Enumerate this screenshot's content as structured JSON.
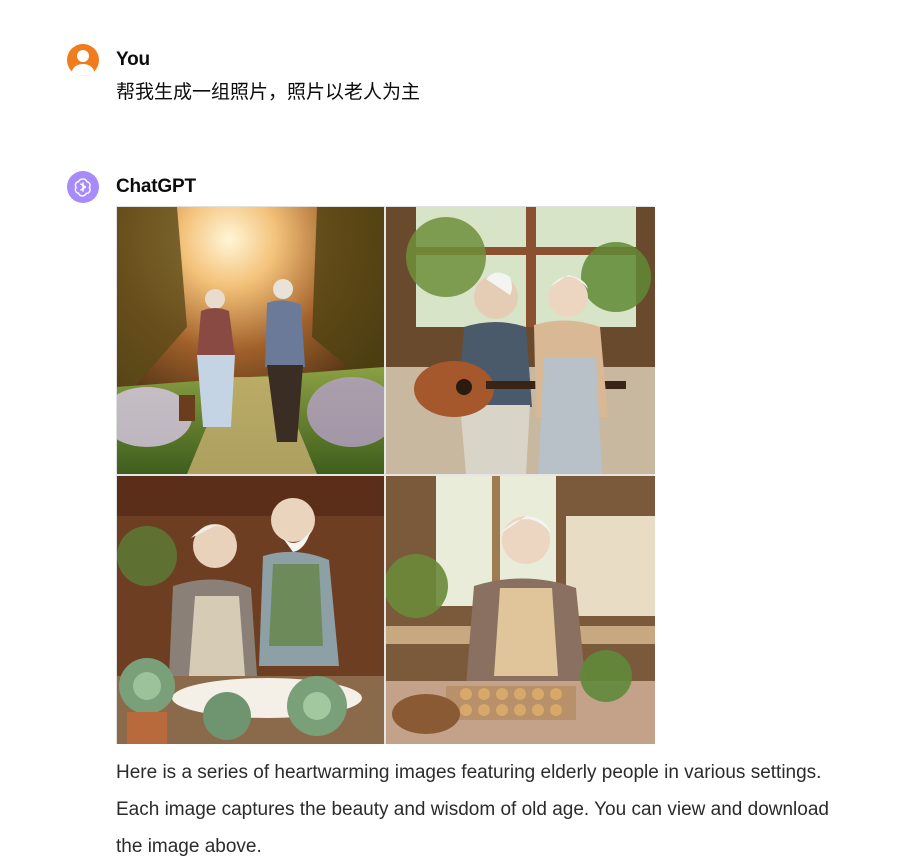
{
  "conversation": {
    "user_message": {
      "author": "You",
      "text": "帮我生成一组照片，照片以老人为主"
    },
    "assistant_message": {
      "author": "ChatGPT",
      "images": [
        {
          "alt": "Elderly couple walking hand in hand in a sunlit garden path"
        },
        {
          "alt": "Elderly couple by a window, man playing guitar"
        },
        {
          "alt": "Elderly couple laughing together at a table with succulents"
        },
        {
          "alt": "Elderly woman baking cookies in a cozy kitchen"
        }
      ],
      "text_lines": [
        "Here is a series of heartwarming images featuring elderly people in various settings.",
        "Each image captures the beauty and wisdom of old age. You can view and download",
        "the image above."
      ]
    }
  },
  "colors": {
    "user_avatar": "#f07c1c",
    "assistant_avatar": "#a78bfa"
  },
  "icons": {
    "user_avatar": "user-icon",
    "assistant_avatar": "openai-logo-icon"
  }
}
